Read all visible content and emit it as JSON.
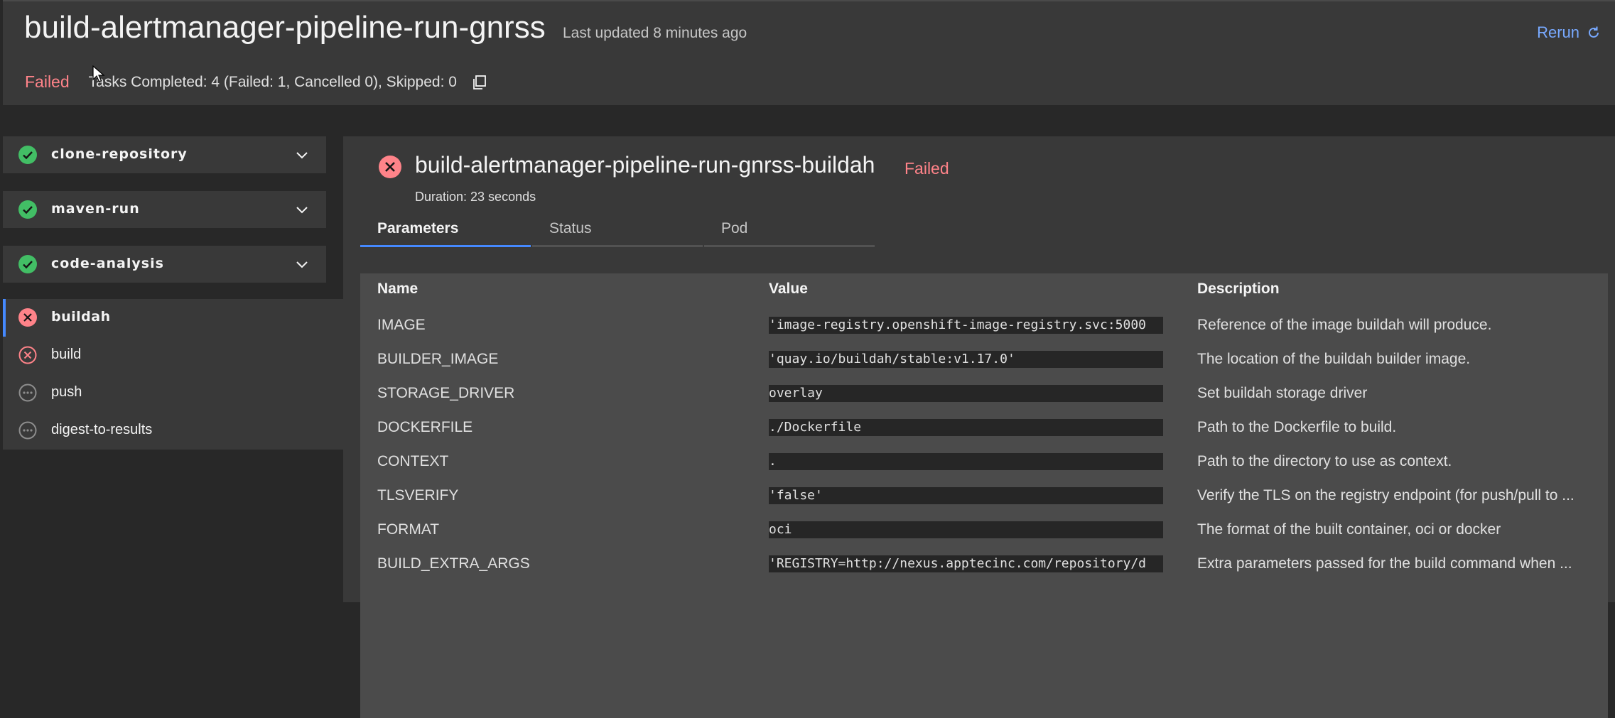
{
  "header": {
    "title": "build-alertmanager-pipeline-run-gnrss",
    "last_updated": "Last updated 8 minutes ago",
    "rerun_label": "Rerun",
    "status": "Failed",
    "tasks_summary": "Tasks Completed: 4 (Failed: 1, Cancelled 0), Skipped: 0"
  },
  "sidebar": {
    "accordions": [
      {
        "label": "clone-repository",
        "icon": "check-circle-icon"
      },
      {
        "label": "maven-run",
        "icon": "check-circle-icon"
      },
      {
        "label": "code-analysis",
        "icon": "check-circle-icon"
      }
    ],
    "steps": [
      {
        "label": "buildah",
        "icon": "error-circle-icon",
        "selected": true
      },
      {
        "label": "build",
        "icon": "error-circle-outline-icon"
      },
      {
        "label": "push",
        "icon": "pending-circle-icon"
      },
      {
        "label": "digest-to-results",
        "icon": "pending-circle-icon"
      }
    ]
  },
  "task": {
    "title": "build-alertmanager-pipeline-run-gnrss-buildah",
    "status": "Failed",
    "duration": "Duration: 23 seconds",
    "tabs": [
      "Parameters",
      "Status",
      "Pod"
    ],
    "table": {
      "headers": [
        "Name",
        "Value",
        "Description"
      ],
      "rows": [
        {
          "name": "IMAGE",
          "value": "'image-registry.openshift-image-registry.svc:5000",
          "description": "Reference of the image buildah will produce."
        },
        {
          "name": "BUILDER_IMAGE",
          "value": "'quay.io/buildah/stable:v1.17.0'",
          "description": "The location of the buildah builder image."
        },
        {
          "name": "STORAGE_DRIVER",
          "value": "overlay",
          "description": "Set buildah storage driver"
        },
        {
          "name": "DOCKERFILE",
          "value": "./Dockerfile",
          "description": "Path to the Dockerfile to build."
        },
        {
          "name": "CONTEXT",
          "value": ".",
          "description": "Path to the directory to use as context."
        },
        {
          "name": "TLSVERIFY",
          "value": "'false'",
          "description": "Verify the TLS on the registry endpoint (for push/pull to ..."
        },
        {
          "name": "FORMAT",
          "value": "oci",
          "description": "The format of the built container, oci or docker"
        },
        {
          "name": "BUILD_EXTRA_ARGS",
          "value": "'REGISTRY=http://nexus.apptecinc.com/repository/d",
          "description": "Extra parameters passed for the build command when ..."
        }
      ]
    }
  },
  "colors": {
    "failed": "#ff8389",
    "success": "#42be65",
    "accent": "#4589ff",
    "link": "#78a9ff"
  }
}
